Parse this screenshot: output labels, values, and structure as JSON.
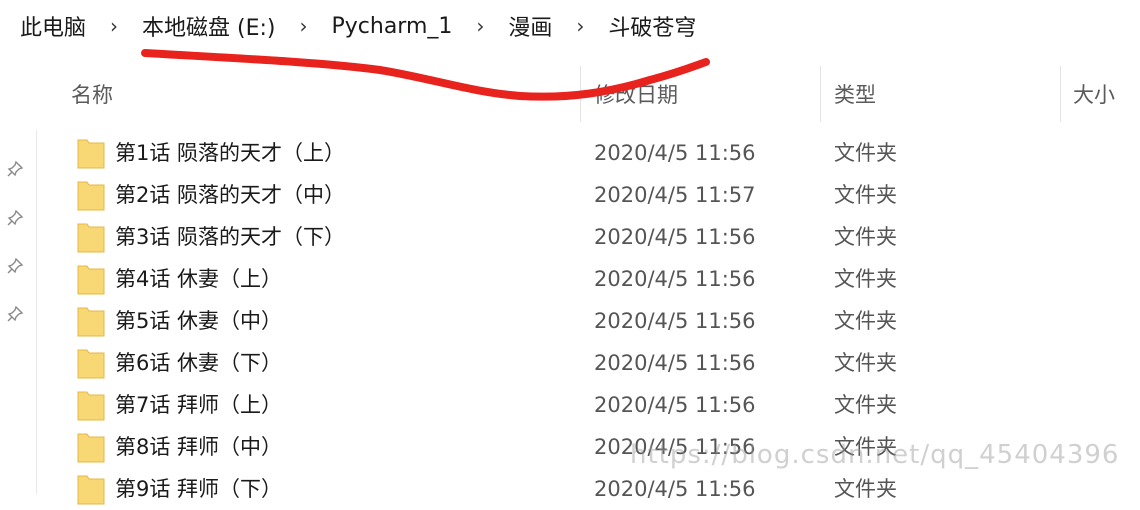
{
  "breadcrumb": {
    "items": [
      "此电脑",
      "本地磁盘 (E:)",
      "Pycharm_1",
      "漫画",
      "斗破苍穹"
    ],
    "separator": "›"
  },
  "columns": {
    "name": "名称",
    "modified": "修改日期",
    "type": "类型",
    "size": "大小"
  },
  "files": [
    {
      "name": "第1话 陨落的天才（上）",
      "modified": "2020/4/5 11:56",
      "type": "文件夹"
    },
    {
      "name": "第2话 陨落的天才（中）",
      "modified": "2020/4/5 11:57",
      "type": "文件夹"
    },
    {
      "name": "第3话 陨落的天才（下）",
      "modified": "2020/4/5 11:56",
      "type": "文件夹"
    },
    {
      "name": "第4话 休妻（上）",
      "modified": "2020/4/5 11:56",
      "type": "文件夹"
    },
    {
      "name": "第5话 休妻（中）",
      "modified": "2020/4/5 11:56",
      "type": "文件夹"
    },
    {
      "name": "第6话 休妻（下）",
      "modified": "2020/4/5 11:56",
      "type": "文件夹"
    },
    {
      "name": "第7话 拜师（上）",
      "modified": "2020/4/5 11:56",
      "type": "文件夹"
    },
    {
      "name": "第8话 拜师（中）",
      "modified": "2020/4/5 11:56",
      "type": "文件夹"
    },
    {
      "name": "第9话 拜师（下）",
      "modified": "2020/4/5 11:56",
      "type": "文件夹"
    }
  ],
  "watermark": "https://blog.csdn.net/qq_45404396",
  "colors": {
    "folder_fill": "#f8d775",
    "folder_edge": "#e6b844",
    "annotation": "#e8221c"
  }
}
